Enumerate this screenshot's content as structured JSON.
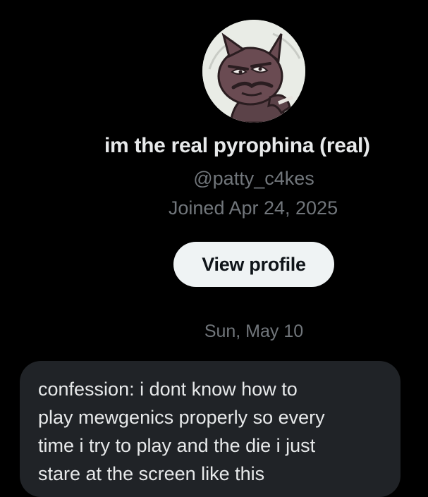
{
  "profile": {
    "display_name": "im the real pyrophina (real)",
    "handle": "@patty_c4kes",
    "joined": "Joined Apr 24, 2025",
    "view_profile_label": "View profile"
  },
  "conversation": {
    "date_separator": "Sun, May 10",
    "messages": [
      {
        "text": "confession: i dont know how to\nplay mewgenics properly so every\ntime i try to play and the die i just\nstare at the screen like this"
      }
    ]
  },
  "colors": {
    "background": "#000000",
    "primary_text": "#e7e9ea",
    "secondary_text": "#71767b",
    "button_bg": "#eff3f4",
    "bubble_bg": "#202327"
  },
  "icons": {
    "avatar": "cartoon-cat-avatar"
  }
}
